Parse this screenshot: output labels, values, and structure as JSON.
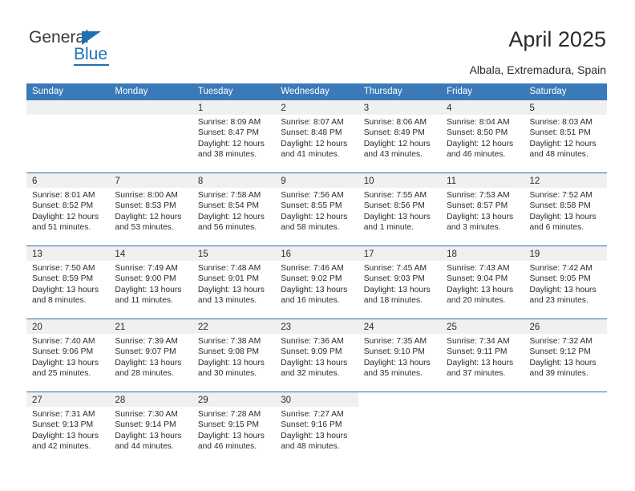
{
  "brand": {
    "name_part1": "General",
    "name_part2": "Blue"
  },
  "header": {
    "title": "April 2025",
    "subtitle": "Albala, Extremadura, Spain"
  },
  "colors": {
    "header_blue": "#3b7ab8",
    "rule_blue": "#2a6db0",
    "band_gray": "#f0f0f0",
    "brand_blue": "#1f6fb5",
    "text": "#2b2b2b"
  },
  "weekdays": [
    "Sunday",
    "Monday",
    "Tuesday",
    "Wednesday",
    "Thursday",
    "Friday",
    "Saturday"
  ],
  "weeks": [
    [
      {
        "day": "",
        "sunrise": "",
        "sunset": "",
        "daylight1": "",
        "daylight2": ""
      },
      {
        "day": "",
        "sunrise": "",
        "sunset": "",
        "daylight1": "",
        "daylight2": ""
      },
      {
        "day": "1",
        "sunrise": "Sunrise: 8:09 AM",
        "sunset": "Sunset: 8:47 PM",
        "daylight1": "Daylight: 12 hours",
        "daylight2": "and 38 minutes."
      },
      {
        "day": "2",
        "sunrise": "Sunrise: 8:07 AM",
        "sunset": "Sunset: 8:48 PM",
        "daylight1": "Daylight: 12 hours",
        "daylight2": "and 41 minutes."
      },
      {
        "day": "3",
        "sunrise": "Sunrise: 8:06 AM",
        "sunset": "Sunset: 8:49 PM",
        "daylight1": "Daylight: 12 hours",
        "daylight2": "and 43 minutes."
      },
      {
        "day": "4",
        "sunrise": "Sunrise: 8:04 AM",
        "sunset": "Sunset: 8:50 PM",
        "daylight1": "Daylight: 12 hours",
        "daylight2": "and 46 minutes."
      },
      {
        "day": "5",
        "sunrise": "Sunrise: 8:03 AM",
        "sunset": "Sunset: 8:51 PM",
        "daylight1": "Daylight: 12 hours",
        "daylight2": "and 48 minutes."
      }
    ],
    [
      {
        "day": "6",
        "sunrise": "Sunrise: 8:01 AM",
        "sunset": "Sunset: 8:52 PM",
        "daylight1": "Daylight: 12 hours",
        "daylight2": "and 51 minutes."
      },
      {
        "day": "7",
        "sunrise": "Sunrise: 8:00 AM",
        "sunset": "Sunset: 8:53 PM",
        "daylight1": "Daylight: 12 hours",
        "daylight2": "and 53 minutes."
      },
      {
        "day": "8",
        "sunrise": "Sunrise: 7:58 AM",
        "sunset": "Sunset: 8:54 PM",
        "daylight1": "Daylight: 12 hours",
        "daylight2": "and 56 minutes."
      },
      {
        "day": "9",
        "sunrise": "Sunrise: 7:56 AM",
        "sunset": "Sunset: 8:55 PM",
        "daylight1": "Daylight: 12 hours",
        "daylight2": "and 58 minutes."
      },
      {
        "day": "10",
        "sunrise": "Sunrise: 7:55 AM",
        "sunset": "Sunset: 8:56 PM",
        "daylight1": "Daylight: 13 hours",
        "daylight2": "and 1 minute."
      },
      {
        "day": "11",
        "sunrise": "Sunrise: 7:53 AM",
        "sunset": "Sunset: 8:57 PM",
        "daylight1": "Daylight: 13 hours",
        "daylight2": "and 3 minutes."
      },
      {
        "day": "12",
        "sunrise": "Sunrise: 7:52 AM",
        "sunset": "Sunset: 8:58 PM",
        "daylight1": "Daylight: 13 hours",
        "daylight2": "and 6 minutes."
      }
    ],
    [
      {
        "day": "13",
        "sunrise": "Sunrise: 7:50 AM",
        "sunset": "Sunset: 8:59 PM",
        "daylight1": "Daylight: 13 hours",
        "daylight2": "and 8 minutes."
      },
      {
        "day": "14",
        "sunrise": "Sunrise: 7:49 AM",
        "sunset": "Sunset: 9:00 PM",
        "daylight1": "Daylight: 13 hours",
        "daylight2": "and 11 minutes."
      },
      {
        "day": "15",
        "sunrise": "Sunrise: 7:48 AM",
        "sunset": "Sunset: 9:01 PM",
        "daylight1": "Daylight: 13 hours",
        "daylight2": "and 13 minutes."
      },
      {
        "day": "16",
        "sunrise": "Sunrise: 7:46 AM",
        "sunset": "Sunset: 9:02 PM",
        "daylight1": "Daylight: 13 hours",
        "daylight2": "and 16 minutes."
      },
      {
        "day": "17",
        "sunrise": "Sunrise: 7:45 AM",
        "sunset": "Sunset: 9:03 PM",
        "daylight1": "Daylight: 13 hours",
        "daylight2": "and 18 minutes."
      },
      {
        "day": "18",
        "sunrise": "Sunrise: 7:43 AM",
        "sunset": "Sunset: 9:04 PM",
        "daylight1": "Daylight: 13 hours",
        "daylight2": "and 20 minutes."
      },
      {
        "day": "19",
        "sunrise": "Sunrise: 7:42 AM",
        "sunset": "Sunset: 9:05 PM",
        "daylight1": "Daylight: 13 hours",
        "daylight2": "and 23 minutes."
      }
    ],
    [
      {
        "day": "20",
        "sunrise": "Sunrise: 7:40 AM",
        "sunset": "Sunset: 9:06 PM",
        "daylight1": "Daylight: 13 hours",
        "daylight2": "and 25 minutes."
      },
      {
        "day": "21",
        "sunrise": "Sunrise: 7:39 AM",
        "sunset": "Sunset: 9:07 PM",
        "daylight1": "Daylight: 13 hours",
        "daylight2": "and 28 minutes."
      },
      {
        "day": "22",
        "sunrise": "Sunrise: 7:38 AM",
        "sunset": "Sunset: 9:08 PM",
        "daylight1": "Daylight: 13 hours",
        "daylight2": "and 30 minutes."
      },
      {
        "day": "23",
        "sunrise": "Sunrise: 7:36 AM",
        "sunset": "Sunset: 9:09 PM",
        "daylight1": "Daylight: 13 hours",
        "daylight2": "and 32 minutes."
      },
      {
        "day": "24",
        "sunrise": "Sunrise: 7:35 AM",
        "sunset": "Sunset: 9:10 PM",
        "daylight1": "Daylight: 13 hours",
        "daylight2": "and 35 minutes."
      },
      {
        "day": "25",
        "sunrise": "Sunrise: 7:34 AM",
        "sunset": "Sunset: 9:11 PM",
        "daylight1": "Daylight: 13 hours",
        "daylight2": "and 37 minutes."
      },
      {
        "day": "26",
        "sunrise": "Sunrise: 7:32 AM",
        "sunset": "Sunset: 9:12 PM",
        "daylight1": "Daylight: 13 hours",
        "daylight2": "and 39 minutes."
      }
    ],
    [
      {
        "day": "27",
        "sunrise": "Sunrise: 7:31 AM",
        "sunset": "Sunset: 9:13 PM",
        "daylight1": "Daylight: 13 hours",
        "daylight2": "and 42 minutes."
      },
      {
        "day": "28",
        "sunrise": "Sunrise: 7:30 AM",
        "sunset": "Sunset: 9:14 PM",
        "daylight1": "Daylight: 13 hours",
        "daylight2": "and 44 minutes."
      },
      {
        "day": "29",
        "sunrise": "Sunrise: 7:28 AM",
        "sunset": "Sunset: 9:15 PM",
        "daylight1": "Daylight: 13 hours",
        "daylight2": "and 46 minutes."
      },
      {
        "day": "30",
        "sunrise": "Sunrise: 7:27 AM",
        "sunset": "Sunset: 9:16 PM",
        "daylight1": "Daylight: 13 hours",
        "daylight2": "and 48 minutes."
      },
      {
        "day": "",
        "sunrise": "",
        "sunset": "",
        "daylight1": "",
        "daylight2": ""
      },
      {
        "day": "",
        "sunrise": "",
        "sunset": "",
        "daylight1": "",
        "daylight2": ""
      },
      {
        "day": "",
        "sunrise": "",
        "sunset": "",
        "daylight1": "",
        "daylight2": ""
      }
    ]
  ]
}
